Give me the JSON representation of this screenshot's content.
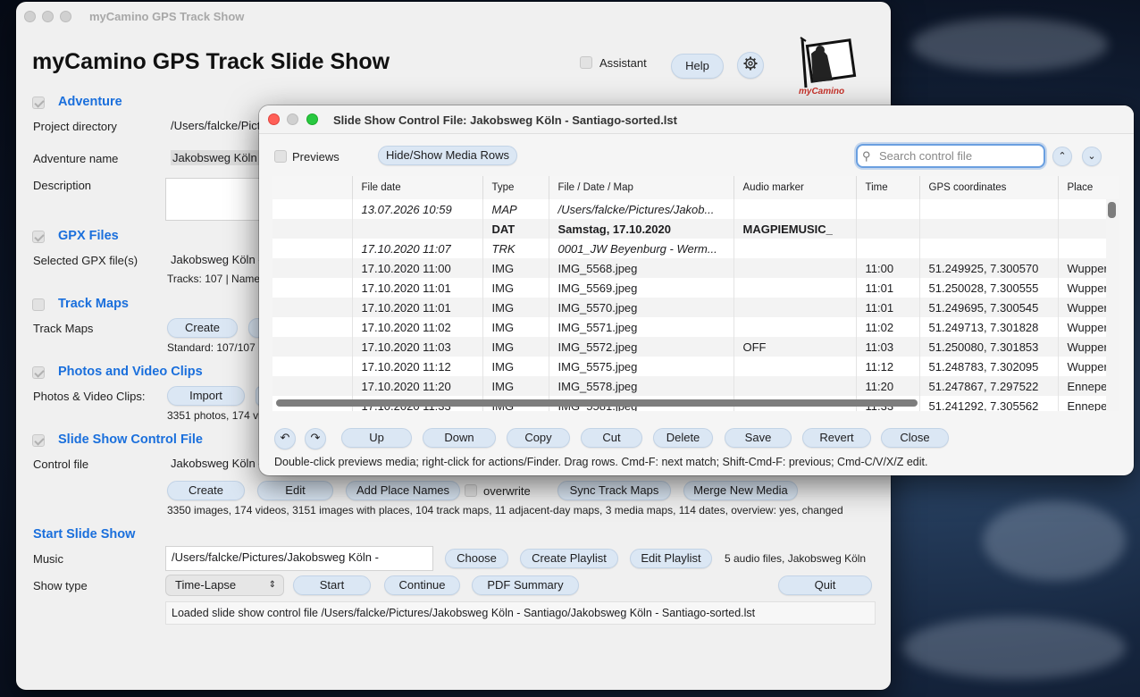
{
  "main": {
    "window_title": "myCamino GPS Track Show",
    "app_title": "myCamino GPS Track Slide Show",
    "assistant_label": "Assistant",
    "help_label": "Help",
    "logo_text": "myCamino",
    "sections": {
      "adventure": "Adventure",
      "gpx": "GPX Files",
      "maps": "Track Maps",
      "photos": "Photos and Video Clips",
      "control": "Slide Show Control File",
      "start": "Start Slide Show"
    },
    "labels": {
      "project_dir": "Project directory",
      "adventure_name": "Adventure name",
      "description": "Description",
      "selected_gpx": "Selected GPX file(s)",
      "track_maps": "Track Maps",
      "photos_clips": "Photos & Video Clips:",
      "control_file": "Control file",
      "music": "Music",
      "show_type": "Show type"
    },
    "values": {
      "project_dir": "/Users/falcke/Pictures/Jakobsweg Köln - Santiago",
      "adventure_name": "Jakobsweg Köln - Santiago",
      "gpx_file": "Jakobsweg Köln - Santiago.gpx",
      "gpx_info": "Tracks: 107 | Name",
      "maps_info": "Standard: 107/107",
      "photos_info": "3351 photos, 174 videos",
      "control_file": "Jakobsweg Köln - Santiago-sorted.lst",
      "control_info": "3350 images, 174 videos, 3151 images with places, 104 track maps, 11 adjacent-day maps, 3 media maps, 114 dates, overview: yes, changed",
      "music": "/Users/falcke/Pictures/Jakobsweg Köln -",
      "music_info": "5 audio files, Jakobsweg Köln",
      "show_type": "Time-Lapse",
      "status": "Loaded slide show control file /Users/falcke/Pictures/Jakobsweg Köln - Santiago/Jakobsweg Köln - Santiago-sorted.lst"
    },
    "buttons": {
      "maps_create": "Create",
      "photos_import": "Import",
      "control_create": "Create",
      "control_edit": "Edit",
      "add_place_names": "Add Place Names",
      "overwrite": "overwrite",
      "sync_track_maps": "Sync Track Maps",
      "merge_new_media": "Merge New Media",
      "choose": "Choose",
      "create_playlist": "Create Playlist",
      "edit_playlist": "Edit Playlist",
      "start": "Start",
      "continue": "Continue",
      "pdf_summary": "PDF Summary",
      "quit": "Quit"
    }
  },
  "dialog": {
    "title": "Slide Show Control File: Jakobsweg Köln - Santiago-sorted.lst",
    "previews_label": "Previews",
    "hide_show_label": "Hide/Show Media Rows",
    "search_placeholder": "Search control file",
    "columns": [
      "File date",
      "Type",
      "File / Date / Map",
      "Audio marker",
      "Time",
      "GPS coordinates",
      "Place"
    ],
    "rows": [
      {
        "date": "13.07.2026 10:59",
        "type": "MAP",
        "file": "/Users/falcke/Pictures/Jakob...",
        "audio": "",
        "time": "",
        "gps": "",
        "place": "",
        "style": "it"
      },
      {
        "date": "",
        "type": "DAT",
        "file": "Samstag, 17.10.2020",
        "audio": "MAGPIEMUSIC_",
        "time": "",
        "gps": "",
        "place": "",
        "style": "bd"
      },
      {
        "date": "17.10.2020 11:07",
        "type": "TRK",
        "file": "0001_JW Beyenburg - Werm...",
        "audio": "",
        "time": "",
        "gps": "",
        "place": "",
        "style": "it"
      },
      {
        "date": "17.10.2020 11:00",
        "type": "IMG",
        "file": "IMG_5568.jpeg",
        "audio": "",
        "time": "11:00",
        "gps": "51.249925, 7.300570",
        "place": "Wuppertal",
        "style": ""
      },
      {
        "date": "17.10.2020 11:01",
        "type": "IMG",
        "file": "IMG_5569.jpeg",
        "audio": "",
        "time": "11:01",
        "gps": "51.250028, 7.300555",
        "place": "Wuppertal",
        "style": ""
      },
      {
        "date": "17.10.2020 11:01",
        "type": "IMG",
        "file": "IMG_5570.jpeg",
        "audio": "",
        "time": "11:01",
        "gps": "51.249695, 7.300545",
        "place": "Wuppertal",
        "style": ""
      },
      {
        "date": "17.10.2020 11:02",
        "type": "IMG",
        "file": "IMG_5571.jpeg",
        "audio": "",
        "time": "11:02",
        "gps": "51.249713, 7.301828",
        "place": "Wuppertal",
        "style": ""
      },
      {
        "date": "17.10.2020 11:03",
        "type": "IMG",
        "file": "IMG_5572.jpeg",
        "audio": "OFF",
        "time": "11:03",
        "gps": "51.250080, 7.301853",
        "place": "Wuppertal",
        "style": ""
      },
      {
        "date": "17.10.2020 11:12",
        "type": "IMG",
        "file": "IMG_5575.jpeg",
        "audio": "",
        "time": "11:12",
        "gps": "51.248783, 7.302095",
        "place": "Wuppertal",
        "style": ""
      },
      {
        "date": "17.10.2020 11:20",
        "type": "IMG",
        "file": "IMG_5578.jpeg",
        "audio": "",
        "time": "11:20",
        "gps": "51.247867, 7.297522",
        "place": "Ennepetal",
        "style": ""
      },
      {
        "date": "17.10.2020 11:33",
        "type": "IMG",
        "file": "IMG_5581.jpeg",
        "audio": "",
        "time": "11:33",
        "gps": "51.241292, 7.305562",
        "place": "Ennepetal",
        "style": ""
      }
    ],
    "buttons": {
      "up": "Up",
      "down": "Down",
      "copy": "Copy",
      "cut": "Cut",
      "delete": "Delete",
      "save": "Save",
      "revert": "Revert",
      "close": "Close"
    },
    "hint": "Double-click previews media; right-click for actions/Finder. Drag rows. Cmd-F: next match; Shift-Cmd-F: previous; Cmd-C/V/X/Z edit."
  }
}
